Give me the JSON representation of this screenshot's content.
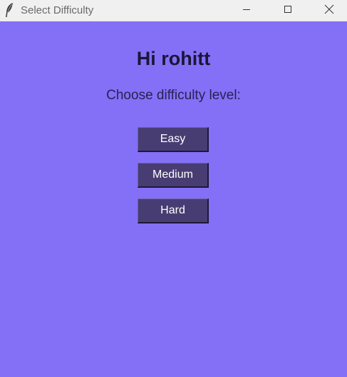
{
  "window": {
    "title": "Select Difficulty",
    "app_icon": "feather-icon",
    "controls": {
      "minimize_icon": "minimize-icon",
      "maximize_icon": "maximize-icon",
      "close_icon": "close-icon"
    }
  },
  "content": {
    "greeting": "Hi rohitt",
    "prompt": "Choose difficulty level:",
    "buttons": [
      {
        "label": "Easy"
      },
      {
        "label": "Medium"
      },
      {
        "label": "Hard"
      }
    ]
  },
  "colors": {
    "background": "#8370f7",
    "button_bg": "#483d73",
    "button_text": "#ffffff",
    "greeting_text": "#1c1538"
  }
}
